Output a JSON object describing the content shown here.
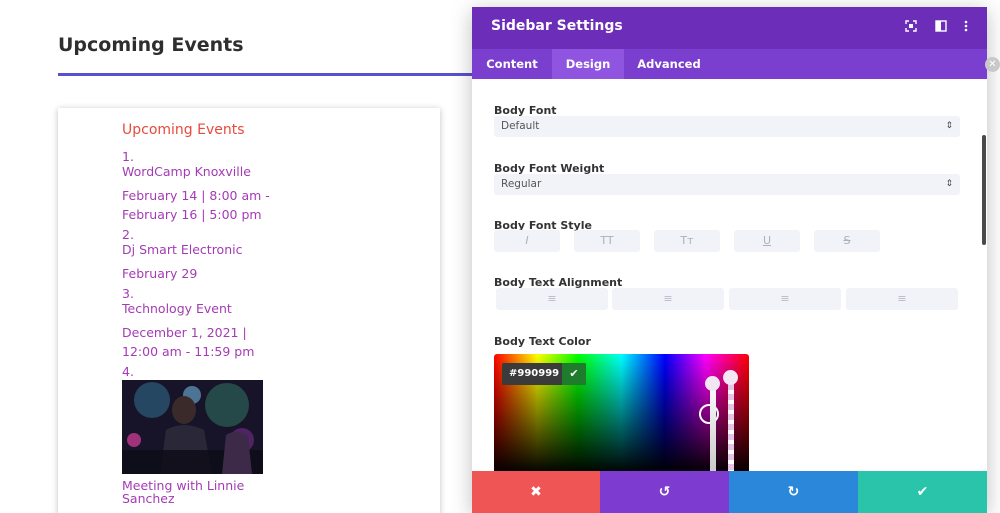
{
  "page": {
    "title": "Upcoming Events"
  },
  "widget": {
    "title": "Upcoming Events",
    "events": [
      {
        "num": "1.",
        "name": "WordCamp Knoxville",
        "date1": "February 14 | 8:00 am -",
        "date2": "February 16 | 5:00 pm"
      },
      {
        "num": "2.",
        "name": "Dj Smart Electronic",
        "date1": "February 29",
        "date2": ""
      },
      {
        "num": "3.",
        "name": "Technology Event",
        "date1": "December 1, 2021 |",
        "date2": "12:00 am - 11:59 pm"
      },
      {
        "num": "4.",
        "name1": "Meeting with Linnie",
        "name2": "Sanchez"
      }
    ]
  },
  "modal": {
    "title": "Sidebar Settings",
    "tabs": [
      "Content",
      "Design",
      "Advanced"
    ],
    "active_tab": "Design",
    "body_font_label": "Body Font",
    "body_font_value": "Default",
    "body_font_weight_label": "Body Font Weight",
    "body_font_weight_value": "Regular",
    "body_font_style_label": "Body Font Style",
    "style_buttons": [
      "I",
      "TT",
      "Tт",
      "U",
      "S"
    ],
    "body_text_alignment_label": "Body Text Alignment",
    "align_buttons": [
      "≡",
      "≡",
      "≡",
      "≡"
    ],
    "body_text_color_label": "Body Text Color",
    "color_hex": "#990999"
  },
  "colors": {
    "header": "#6c2eb9",
    "tabs": "#7b3fd0",
    "cancel": "#ef5555",
    "undo": "#7e3bd0",
    "redo": "#2b87da",
    "save": "#29c4a9",
    "event_text": "#a43bb5",
    "widget_title": "#e84a3d"
  },
  "footer": {
    "cancel_icon": "✖",
    "undo_icon": "↺",
    "redo_icon": "↻",
    "save_icon": "✔"
  }
}
